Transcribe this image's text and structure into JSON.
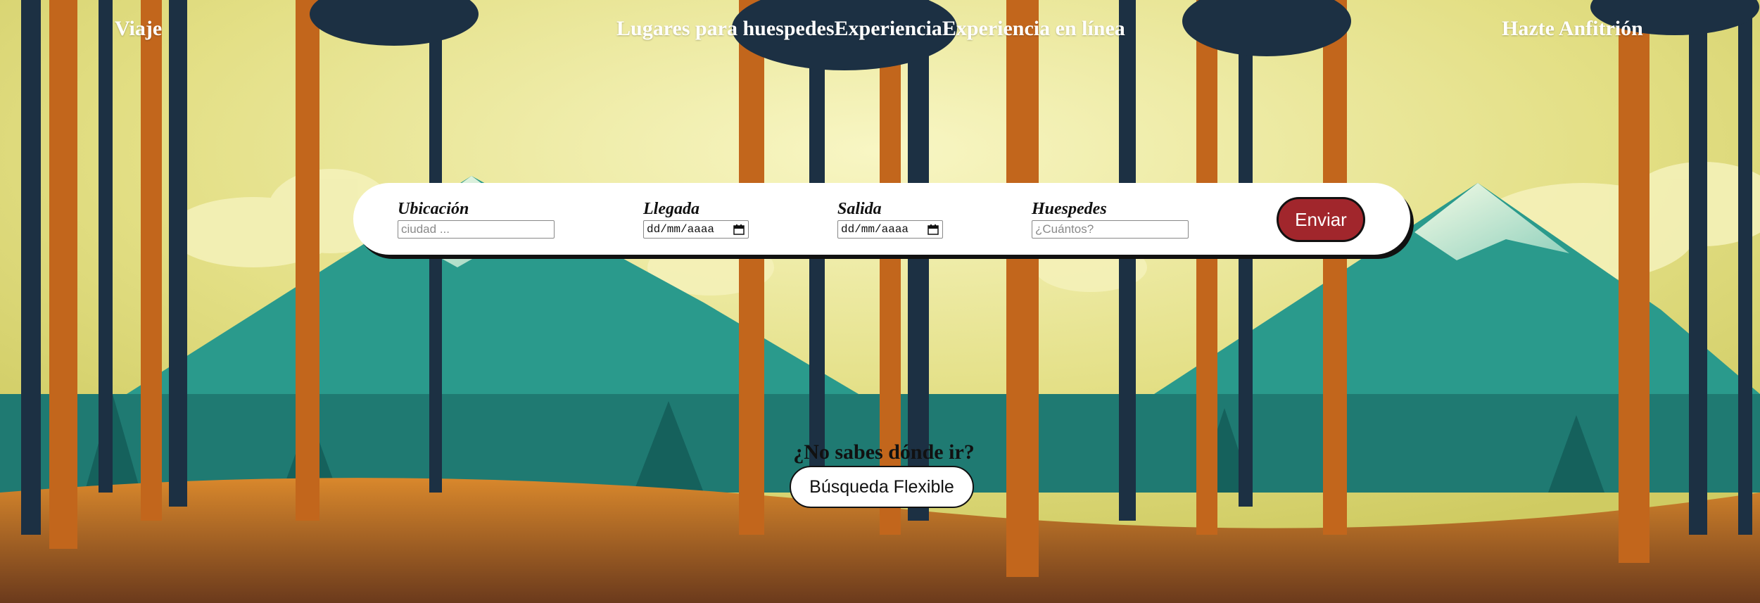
{
  "nav": {
    "brand": "Viaje",
    "links": [
      "Lugares para huespedes",
      "Experiencia",
      "Experiencia en línea"
    ],
    "host_link": "Hazte Anfitrión"
  },
  "search": {
    "location": {
      "label": "Ubicación",
      "placeholder": "ciudad ..."
    },
    "arrival": {
      "label": "Llegada",
      "placeholder": "dd/mm/aaaa"
    },
    "departure": {
      "label": "Salida",
      "placeholder": "dd/mm/aaaa"
    },
    "guests": {
      "label": "Huespedes",
      "placeholder": "¿Cuántos?"
    },
    "submit_label": "Enviar"
  },
  "flexible": {
    "question": "¿No sabes dónde ir?",
    "button_label": "Búsqueda Flexible"
  },
  "colors": {
    "submit_button": "#a1262c",
    "sky": "#e7e289",
    "mountain": "#2a9a8c",
    "tree_trunk": "#c2661c",
    "tree_dark": "#1c3043"
  },
  "icons": [
    "calendar-icon",
    "calendar-icon"
  ]
}
